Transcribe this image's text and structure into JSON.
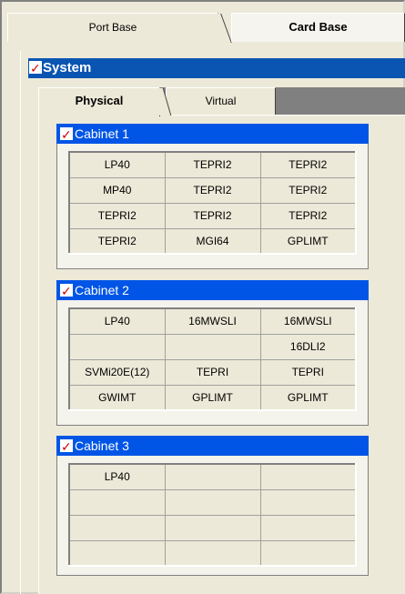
{
  "top_tabs": {
    "port_base": "Port Base",
    "card_base": "Card Base"
  },
  "system": {
    "label": "System"
  },
  "inner_tabs": {
    "physical": "Physical",
    "virtual": "Virtual"
  },
  "cabinets": [
    {
      "label": "Cabinet 1",
      "rows": [
        [
          "LP40",
          "TEPRI2",
          "TEPRI2"
        ],
        [
          "MP40",
          "TEPRI2",
          "TEPRI2"
        ],
        [
          "TEPRI2",
          "TEPRI2",
          "TEPRI2"
        ],
        [
          "TEPRI2",
          "MGI64",
          "GPLIMT"
        ]
      ]
    },
    {
      "label": "Cabinet 2",
      "rows": [
        [
          "LP40",
          "16MWSLI",
          "16MWSLI"
        ],
        [
          "",
          "",
          "16DLI2"
        ],
        [
          "SVMi20E(12)",
          "TEPRI",
          "TEPRI"
        ],
        [
          "GWIMT",
          "GPLIMT",
          "GPLIMT"
        ]
      ]
    },
    {
      "label": "Cabinet 3",
      "rows": [
        [
          "LP40",
          "",
          ""
        ],
        [
          "",
          "",
          ""
        ],
        [
          "",
          "",
          ""
        ],
        [
          "",
          "",
          ""
        ]
      ]
    }
  ]
}
